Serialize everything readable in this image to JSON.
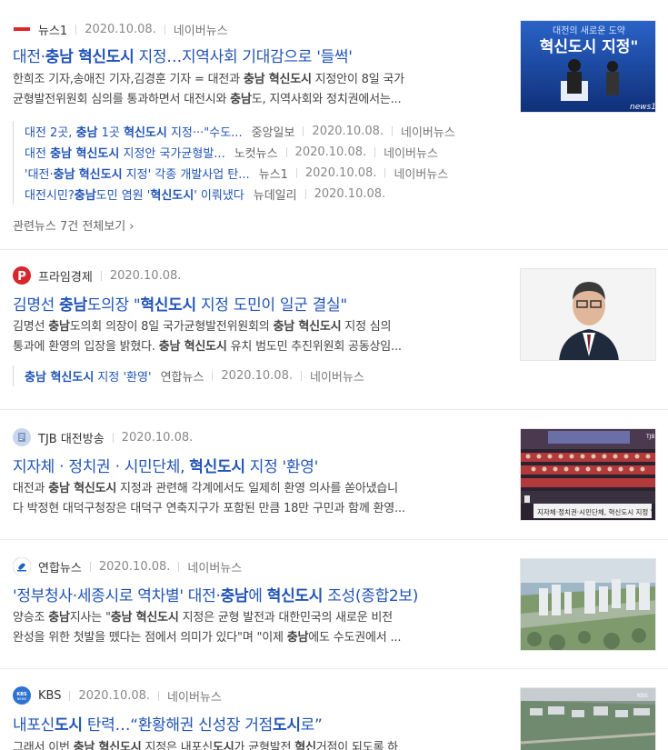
{
  "items": [
    {
      "press": "뉴스1",
      "date": "2020.10.08.",
      "naver": "네이버뉴스",
      "title": "대전·충남 혁신도시 지정…지역사회 기대감으로 '들썩'",
      "desc1": "한희조 기자,송애진 기자,김경훈 기자 = 대전과 충남 혁신도시 지정안이 8일 국가",
      "desc2": "균형발전위원회 심의를 통과하면서 대전시와 충남도, 지역사회와 정치권에서는...",
      "thumb_text": "대전의 새로운 도약 혁신도시 지정",
      "thumb_brand": "news1",
      "related": [
        {
          "title": "대전 2곳, 충남 1곳 혁신도시 지정···\"수도...",
          "press": "중앙일보",
          "date": "2020.10.08.",
          "naver": "네이버뉴스"
        },
        {
          "title": "대전 충남 혁신도시 지정안 국가균형발...",
          "press": "노컷뉴스",
          "date": "2020.10.08.",
          "naver": "네이버뉴스"
        },
        {
          "title": "'대전·충남 혁신도시 지정' 각종 개발사업 탄...",
          "press": "뉴스1",
          "date": "2020.10.08.",
          "naver": "네이버뉴스"
        },
        {
          "title": "대전시민?충남도민 염원 '혁신도시' 이뤄냈다",
          "press": "뉴데일리",
          "date": "2020.10.08.",
          "naver": ""
        }
      ],
      "more": "관련뉴스 7건 전체보기 ›"
    },
    {
      "press": "프라임경제",
      "date": "2020.10.08.",
      "title": "김명선 충남도의장 \"혁신도시 지정 도민이 일군 결실\"",
      "desc1": "김명선 충남도의회 의장이 8일 국가균형발전위원회의 충남 혁신도시 지정 심의",
      "desc2": "통과에 환영의 입장을 밝혔다. 충남 혁신도시 유치 범도민 추진위원회 공동상임...",
      "related": [
        {
          "title": "충남 혁신도시 지정 '환영'",
          "press": "연합뉴스",
          "date": "2020.10.08.",
          "naver": "네이버뉴스"
        }
      ]
    },
    {
      "press": "TJB 대전방송",
      "date": "2020.10.08.",
      "title": "지자체ㆍ정치권ㆍ시민단체, 혁신도시 지정 '환영'",
      "desc1": "대전과 충남 혁신도시 지정과 관련해 각계에서도 일제히 환영 의사를 쏟아냈습니",
      "desc2": "다 박정현 대덕구청장은 대덕구 연축지구가 포함된 만큼 18만 구민과 함께 환영...",
      "thumb_caption": "지자체·정치권·시민단체, 혁신도시 지정 '환영'",
      "thumb_brand": "TJB"
    },
    {
      "press": "연합뉴스",
      "date": "2020.10.08.",
      "naver": "네이버뉴스",
      "title": "'정부청사·세종시로 역차별' 대전·충남에 혁신도시 조성(종합2보)",
      "desc1": "양승조 충남지사는 \"충남 혁신도시 지정은 균형 발전과 대한민국의 새로운 비전",
      "desc2": "완성을 위한 첫발을 뗐다는 점에서 의미가 있다\"며 \"이제 충남에도 수도권에서 ..."
    },
    {
      "press": "KBS",
      "date": "2020.10.08.",
      "naver": "네이버뉴스",
      "title": "내포신도시 탄력…“환황해권 신성장 거점도시로”",
      "desc1": "그래서 이번 충남 혁신도시 지정은 내포신도시가 균형발전 혁신거점이 되도록 하"
    }
  ],
  "colors": {
    "link": "#2154b6",
    "text": "#444444",
    "meta": "#888888"
  }
}
